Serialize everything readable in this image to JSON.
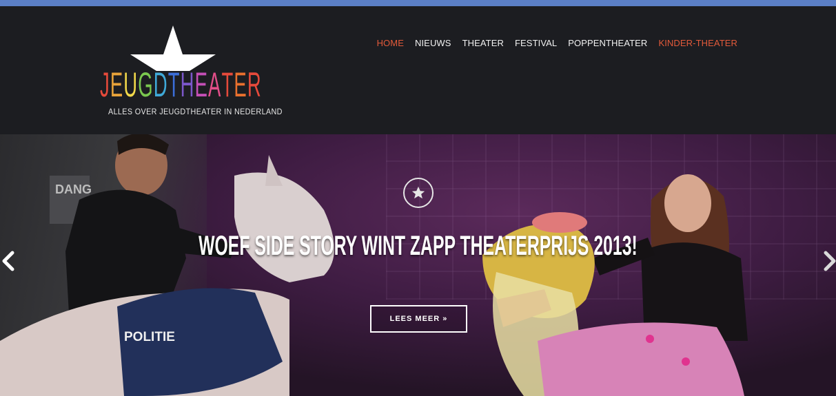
{
  "theme": {
    "topbar_color": "#5b7fc6",
    "header_bg": "#1c1d21",
    "nav_active_color": "#e35a3a",
    "logo_letter_colors": [
      "#e64a3b",
      "#e8a33a",
      "#f1d84a",
      "#7ac74f",
      "#3fa9d8",
      "#3b6ed8",
      "#7b57c9",
      "#c44fb6",
      "#e24e89",
      "#e64a3b",
      "#e8702e"
    ]
  },
  "logo": {
    "wordmark": "JEUGDTHEATER",
    "tagline": "ALLES OVER JEUGDTHEATER IN NEDERLAND",
    "icon": "star-icon"
  },
  "nav": {
    "items": [
      {
        "label": "HOME",
        "active": true
      },
      {
        "label": "NIEUWS",
        "active": false
      },
      {
        "label": "THEATER",
        "active": false
      },
      {
        "label": "FESTIVAL",
        "active": false
      },
      {
        "label": "POPPENTHEATER",
        "active": false
      },
      {
        "label": "KINDER-THEATER",
        "active": true
      }
    ]
  },
  "hero": {
    "badge_icon": "star-icon",
    "title": "WOEF SIDE STORY WINT ZAPP THEATERPRIJS 2013!",
    "cta_label": "LEES MEER »",
    "prev_icon": "chevron-left-icon",
    "next_icon": "chevron-right-icon",
    "scene_text_vest": "POLITIE",
    "scene_text_sign": "DANG"
  }
}
